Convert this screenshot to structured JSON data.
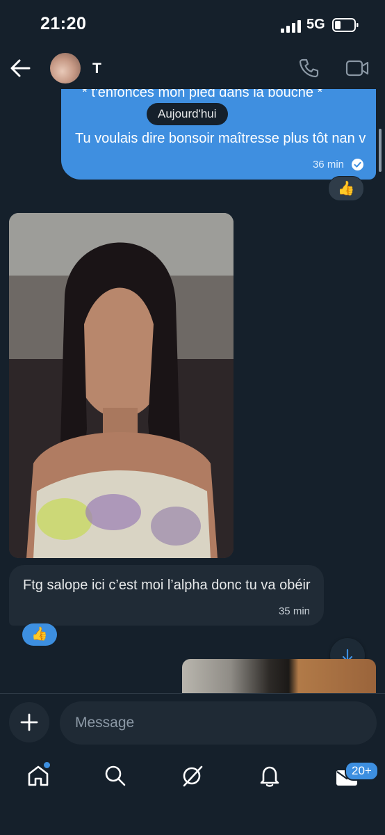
{
  "status_bar": {
    "time": "21:20",
    "network": "5G"
  },
  "header": {
    "contact_name": "T"
  },
  "sent_message": {
    "partial_text": "* t'enfonces mon pied dans la bouche *",
    "date_separator": "Aujourd'hui",
    "text": "Tu voulais dire bonsoir maîtresse plus tôt nan v",
    "time": "36 min",
    "reaction": "👍"
  },
  "received_message": {
    "text": "Ftg salope ici c’est moi l’alpha donc tu va obéir",
    "time": "35 min",
    "reaction": "👍"
  },
  "composer": {
    "placeholder": "Message"
  },
  "nav": {
    "messages_badge": "20+"
  },
  "colors": {
    "background": "#15202b",
    "accent": "#3d8fe0",
    "sent_bubble": "#3f8fe0",
    "received_bubble": "#202b36"
  }
}
